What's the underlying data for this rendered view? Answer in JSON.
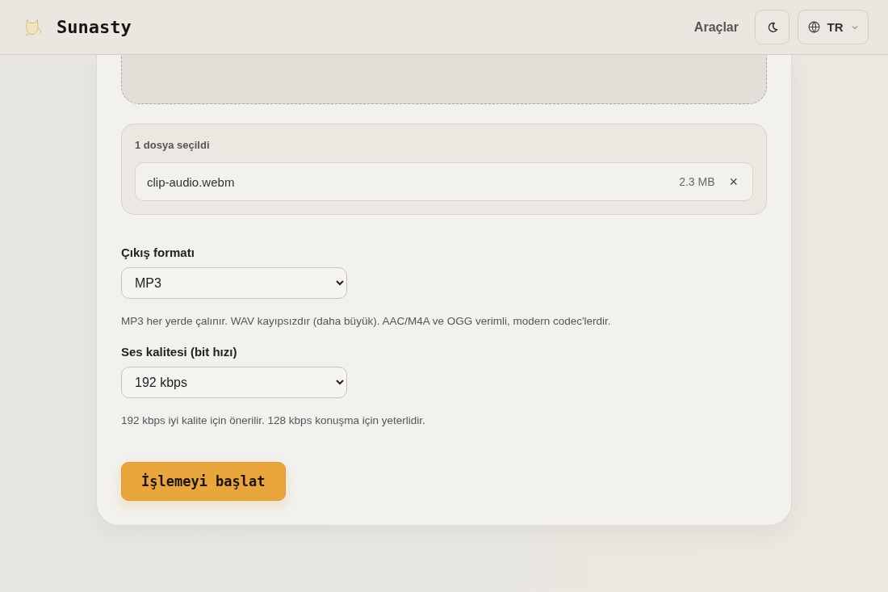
{
  "header": {
    "brand": "Sunasty",
    "nav_link": "Araçlar",
    "language": "TR"
  },
  "selected_files": {
    "title": "1 dosya seçildi",
    "files": [
      {
        "name": "clip-audio.webm",
        "size": "2.3 MB",
        "remove": "×"
      }
    ]
  },
  "fields": [
    {
      "label": "Çıkış formatı",
      "value": "MP3",
      "help": "MP3 her yerde çalınır. WAV kayıpsızdır (daha büyük). AAC/M4A ve OGG verimli, modern codec'lerdir."
    },
    {
      "label": "Ses kalitesi (bit hızı)",
      "value": "192 kbps",
      "help": "192 kbps iyi kalite için önerilir. 128 kbps konuşma için yeterlidir."
    }
  ],
  "start_button": "İşlemeyi başlat"
}
